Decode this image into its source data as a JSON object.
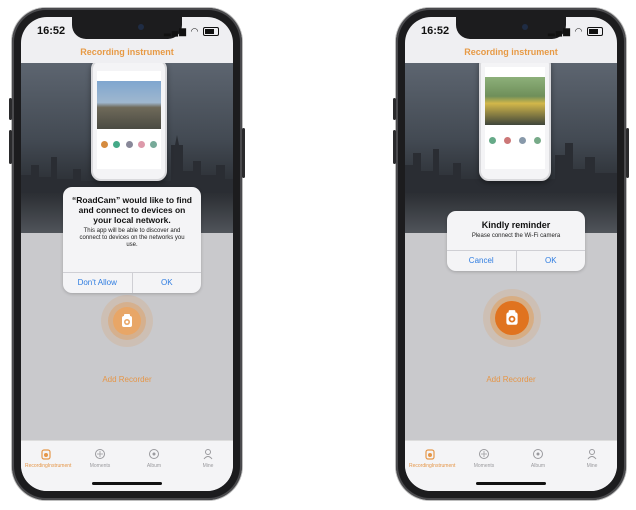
{
  "accent_color": "#e59648",
  "left": {
    "status_time": "16:52",
    "nav_title": "Recording instrument",
    "dialog": {
      "title": "“RoadCam” would like to find and connect to devices on your local network.",
      "message": "This app will be able to discover and connect to devices on the networks you use.",
      "deny_label": "Don't Allow",
      "ok_label": "OK"
    },
    "add_recorder_label": "Add Recorder",
    "tabs": [
      {
        "label": "RecordingInstrument",
        "icon": "dashcam-icon",
        "active": true
      },
      {
        "label": "Moments",
        "icon": "moments-icon",
        "active": false
      },
      {
        "label": "Album",
        "icon": "album-icon",
        "active": false
      },
      {
        "label": "Mine",
        "icon": "person-icon",
        "active": false
      }
    ]
  },
  "right": {
    "status_time": "16:52",
    "nav_title": "Recording instrument",
    "dialog": {
      "title": "Kindly reminder",
      "message": "Please connect the Wi-Fi camera",
      "cancel_label": "Cancel",
      "ok_label": "OK"
    },
    "add_recorder_label": "Add Recorder",
    "tabs": [
      {
        "label": "RecordingInstrument",
        "icon": "dashcam-icon",
        "active": true
      },
      {
        "label": "Moments",
        "icon": "moments-icon",
        "active": false
      },
      {
        "label": "Album",
        "icon": "album-icon",
        "active": false
      },
      {
        "label": "Mine",
        "icon": "person-icon",
        "active": false
      }
    ]
  }
}
